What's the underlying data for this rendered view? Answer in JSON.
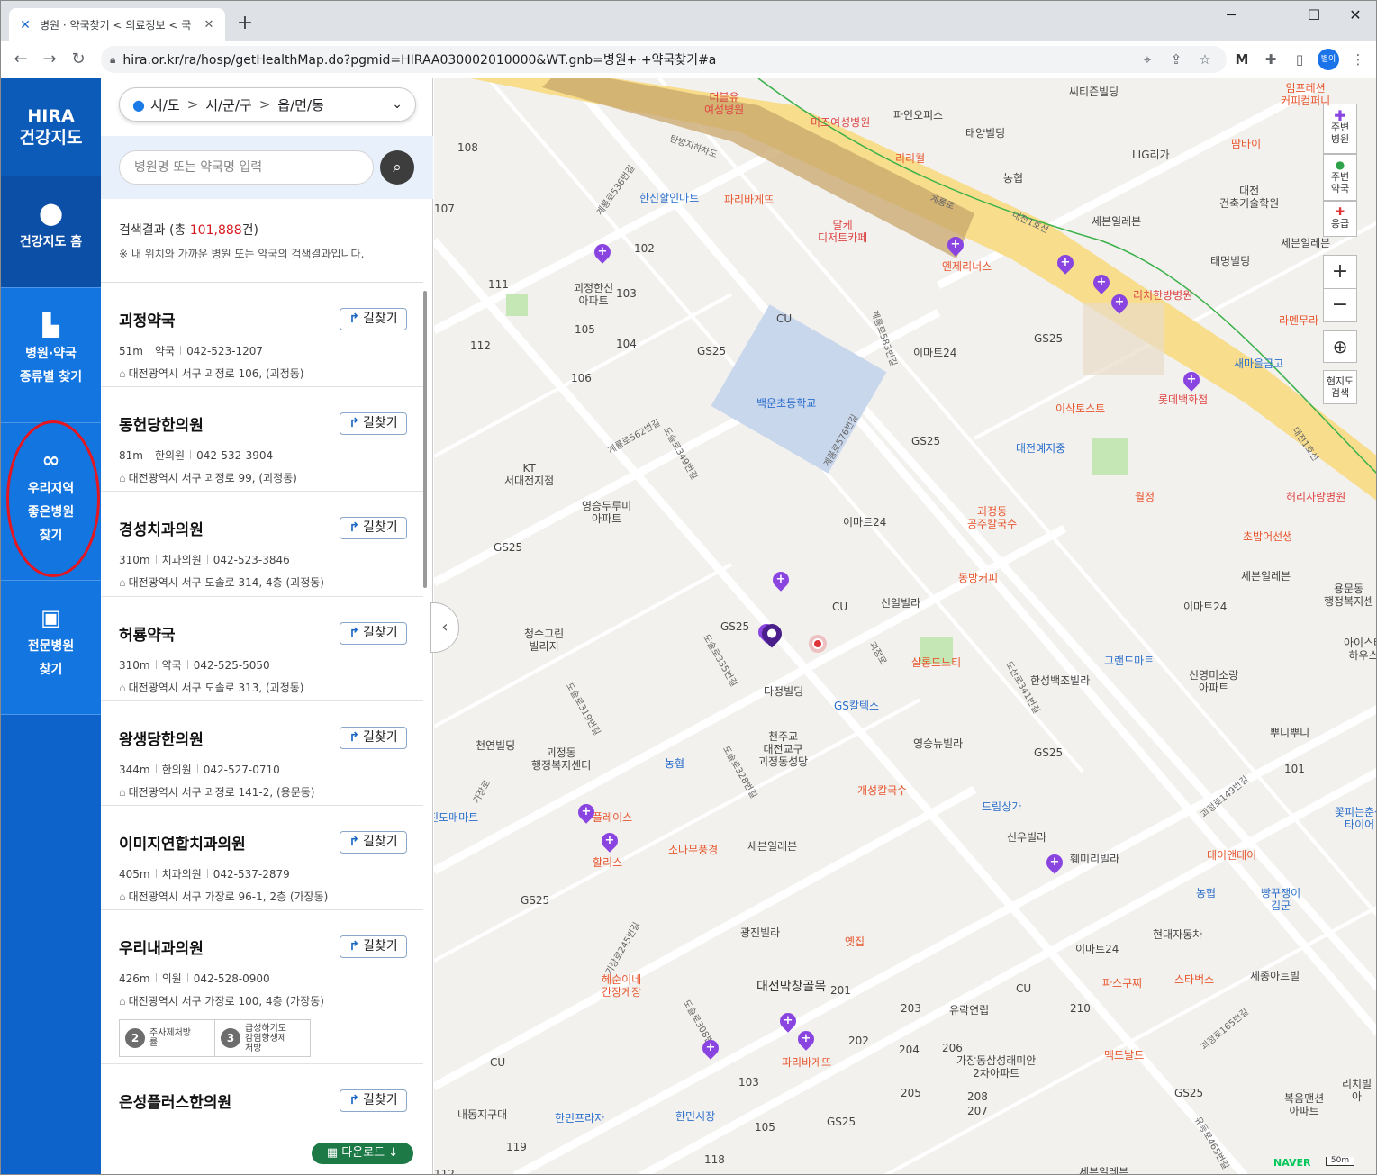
{
  "browser": {
    "tab_title": "병원 · 약국찾기 < 의료정보 < 국",
    "tab_close": "✕",
    "new_tab": "+",
    "url": "hira.or.kr/ra/hosp/getHealthMap.do?pgmid=HIRAA030002010000&WT.gnb=병원+·+약국찾기#a",
    "profile": "별이",
    "window_min": "─",
    "window_max": "☐",
    "window_close": "✕"
  },
  "sidebar": {
    "logo_line1": "HIRA",
    "logo_line2": "건강지도",
    "items": [
      {
        "label1": "건강지도 홈",
        "label2": ""
      },
      {
        "label1": "병원·약국",
        "label2": "종류별 찾기"
      },
      {
        "label1": "우리지역",
        "label2": "좋은병원",
        "label3": "찾기"
      },
      {
        "label1": "전문병원",
        "label2": "찾기"
      }
    ]
  },
  "panel": {
    "region": {
      "sido": "시/도",
      "sigungu": "시/군/구",
      "dong": "읍/면/동"
    },
    "search_placeholder": "병원명 또는 약국명 입력",
    "result_prefix": "검색결과 (총 ",
    "result_count": "101,888",
    "result_suffix": "건)",
    "result_note": "※ 내 위치와 가까운 병원 또는 약국의 검색결과입니다.",
    "route_label": "길찾기",
    "download_label": "다운로드",
    "results": [
      {
        "name": "괴정약국",
        "dist": "51m",
        "type": "약국",
        "tel": "042-523-1207",
        "addr": "대전광역시 서구 괴정로 106, (괴정동)"
      },
      {
        "name": "동헌당한의원",
        "dist": "81m",
        "type": "한의원",
        "tel": "042-532-3904",
        "addr": "대전광역시 서구 괴정로 99, (괴정동)"
      },
      {
        "name": "경성치과의원",
        "dist": "310m",
        "type": "치과의원",
        "tel": "042-523-3846",
        "addr": "대전광역시 서구 도솔로 314, 4층 (괴정동)"
      },
      {
        "name": "허룡약국",
        "dist": "310m",
        "type": "약국",
        "tel": "042-525-5050",
        "addr": "대전광역시 서구 도솔로 313, (괴정동)"
      },
      {
        "name": "왕생당한의원",
        "dist": "344m",
        "type": "한의원",
        "tel": "042-527-0710",
        "addr": "대전광역시 서구 괴정로 141-2, (용문동)"
      },
      {
        "name": "이미지연합치과의원",
        "dist": "405m",
        "type": "치과의원",
        "tel": "042-537-2879",
        "addr": "대전광역시 서구 가장로 96-1, 2층 (가장동)"
      },
      {
        "name": "우리내과의원",
        "dist": "426m",
        "type": "의원",
        "tel": "042-528-0900",
        "addr": "대전광역시 서구 가장로 100, 4층 (가장동)",
        "badges": [
          {
            "num": "2",
            "text1": "주사제처방",
            "text2": "률"
          },
          {
            "num": "3",
            "text1": "급성하기도",
            "text2": "감염항생제",
            "text3": "처방"
          }
        ]
      },
      {
        "name": "은성플러스한의원",
        "dist": "",
        "type": "",
        "tel": "",
        "addr": ""
      }
    ]
  },
  "map_controls": {
    "nearby_hospital": [
      "주변",
      "병원"
    ],
    "nearby_pharmacy": [
      "주변",
      "약국"
    ],
    "emergency": "응급",
    "zoom_in": "+",
    "zoom_out": "−",
    "local_search": [
      "현지도",
      "검색"
    ],
    "naver": "NAVER",
    "scale": "50m"
  },
  "map_labels": {
    "tanbang": "탄방지하차도",
    "gyeryongro": "계룡로",
    "daejeon1": "대전1호선",
    "daejeon1b": "대전1호선",
    "deobeulyu": [
      "더블유",
      "여성병원"
    ],
    "mizz": "미즈여성병원",
    "pine": "파인오피스",
    "taeyang": "태양빌딩",
    "riricall": "리리컬",
    "nonghyup1": "농협",
    "lg": "LIG리가",
    "withbank": "씨티즌빌딩",
    "impression": [
      "임프레션",
      "커피컴퍼니"
    ],
    "ddambai": "땀바이",
    "daejeon_arch": [
      "대전",
      "건축기술학원"
    ],
    "seven1": "세븐일레븐",
    "seven2": "세븐일레븐",
    "taemyung": "태명빌딩",
    "hanshin": "한신할인마트",
    "paris1": "파리바게뜨",
    "dalke": [
      "달케",
      "디저트카페"
    ],
    "gyeryong536": "계룡로536번길",
    "goejeong_hanshin": [
      "괴정한신",
      "아파트"
    ],
    "entry": "엔제리너스",
    "rich": "리치한방병원",
    "lamenra": "라멘무라",
    "cu1": "CU",
    "gs25_1": "GS25",
    "gs25_2": "GS25",
    "emart1": "이마트24",
    "saemaeul": "새마을금고",
    "lotte": "롯데백화점",
    "baegun": "백운초등학교",
    "gyeryong562": "계룡로562번길",
    "dosol349": "도솔로349번길",
    "gs25_3": "GS25",
    "isak": "이삭토스트",
    "kt": [
      "KT",
      "서대전지점"
    ],
    "daejeonyeji": "대전예지중",
    "wolseong": "월정",
    "heori": "허리사랑병원",
    "youngseung": [
      "영승두루미",
      "아파트"
    ],
    "gs25_4": "GS25",
    "emart2": "이마트24",
    "goejeong_kal": [
      "괴정동",
      "공주칼국수"
    ],
    "chobap": "초밥어선생",
    "sinil": "신일빌라",
    "cu2": "CU",
    "dongbang": "동방커피",
    "seven3": "세븐일레븐",
    "emart3": "이마트24",
    "yongmun": [
      "용문동",
      "행정복지센"
    ],
    "cheongsu": [
      "청수그린",
      "빌리지"
    ],
    "gs25_5": "GS25",
    "salrung": "살롱드느티",
    "grand": "그랜드마트",
    "hansung": "한성백조빌라",
    "sinyoung": [
      "신영미소랑",
      "아파트"
    ],
    "dosol335": "도솔로335번길",
    "dajeong": "다정빌딩",
    "gscal": "GS칼텍스",
    "iceshoe": [
      "아이스테",
      "하우스"
    ],
    "cheonyeon": "천연빌딩",
    "goejeong_center": [
      "괴정동",
      "행정복지센터"
    ],
    "nonghyup2": "농협",
    "catholic": [
      "천주교",
      "대전교구",
      "괴정동성당"
    ],
    "yeongseung_nyu": "영승뉴빌라",
    "gs25_6": "GS25",
    "ppuni": "뿌니뿌니",
    "gaejeongdomae": "진도매마트",
    "plaza": "플레이스",
    "gaeseong": "개성칼국수",
    "dream": "드림상가",
    "kkotpi": [
      "꽃피는춘성",
      "타이어"
    ],
    "hollys": "할리스",
    "sonamu": "소나무풍경",
    "seven4": "세븐일레븐",
    "sinwoo": "신우빌라",
    "hwemiri": "훼미리빌라",
    "daeyi": "데이앤데이",
    "gs25_7": "GS25",
    "nonghyup3": "농협",
    "ppang": [
      "빵꾸쟁이",
      "김군"
    ],
    "gwangjin": "광진빌라",
    "yetjip": "옛집",
    "hyundai": "현대자동차",
    "emart4": "이마트24",
    "hyesuni": [
      "헤순이네",
      "간장게장"
    ],
    "alley": "대전막창골목",
    "cu3": "CU",
    "pascu": "파스쿠찌",
    "starbucks": "스타벅스",
    "sejong": "세종아트빌",
    "yuak": "유락연립",
    "paris2": "파리바게뜨",
    "gajang": [
      "가장동삼성래미안",
      "2차아파트"
    ],
    "mcd": "맥도날드",
    "bokum": [
      "복음맨션",
      "아파트"
    ],
    "richi2": [
      "리치빌",
      "아"
    ],
    "cu4": "CU",
    "gs25_8": "GS25",
    "gs25_9": "GS25",
    "naedong": "내동지구대",
    "hanmin": "한민프라자",
    "hanmin_mkt": "한민시장",
    "seven5": "세븐일레븐",
    "goejeong": "괴정로",
    "gajangro": "가장로",
    "dosol319": "도솔로319번길",
    "dosol328": "도솔로328번길",
    "dosol341": "도산로341번길",
    "gaejang245": "가장로245번길",
    "dosol308": "도솔로308번길",
    "gaejeong149": "괴정로149번길",
    "gaejeong165": "괴정로165번길",
    "yudong465": "유등로465번길",
    "gyeryong576": "계룡로576번길",
    "gyeryong583": "계룡로583번길",
    "n108": "108",
    "n107": "107",
    "n102": "102",
    "n103": "103",
    "n111": "111",
    "n112": "112",
    "n105": "105",
    "n104": "104",
    "n106": "106",
    "n101": "101",
    "n201": "201",
    "n202": "202",
    "n203": "203",
    "n204": "204",
    "n205": "205",
    "n206": "206",
    "n207": "207",
    "n208": "208",
    "n210": "210",
    "n103b": "103",
    "n105b": "105",
    "n119": "119",
    "n118": "118",
    "n112b": "112"
  }
}
